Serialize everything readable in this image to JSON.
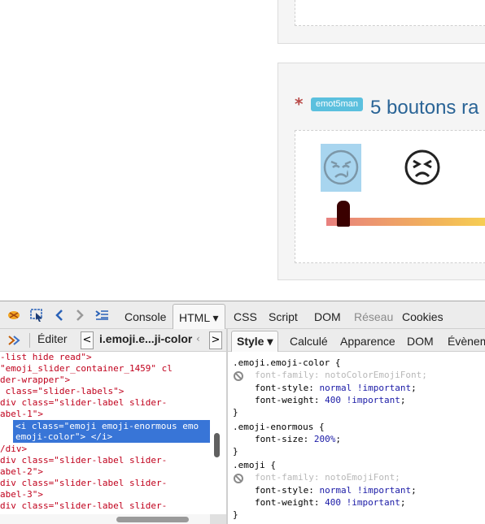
{
  "page": {
    "question": {
      "asterisk": "*",
      "badge": "emot5man",
      "title": "5 boutons ra"
    }
  },
  "devtools": {
    "main_tabs": [
      {
        "label": "Console"
      },
      {
        "label": "HTML",
        "arrow": "▾"
      },
      {
        "label": "CSS"
      },
      {
        "label": "Script"
      },
      {
        "label": "DOM"
      },
      {
        "label": "Réseau"
      },
      {
        "label": "Cookies"
      }
    ],
    "html_toolbar": {
      "edit_label": "Éditer",
      "breadcrumb": "i.emoji.e...ji-color",
      "prev": "<",
      "next": ">",
      "scroll_arrow": "‹"
    },
    "side_tabs": [
      {
        "label": "Style",
        "arrow": "▾"
      },
      {
        "label": "Calculé"
      },
      {
        "label": "Apparence"
      },
      {
        "label": "DOM"
      },
      {
        "label": "Évènem"
      }
    ],
    "html_lines": [
      {
        "text": "-list hide read\">"
      },
      {
        "text": "\"emoji_slider_container_1459\" cl"
      },
      {
        "text": "der-wrapper\">"
      },
      {
        "text": " class=\"slider-labels\">"
      },
      {
        "text": "div class=\"slider-label slider-"
      },
      {
        "text": "abel-1\">"
      },
      {
        "text": "<i class=\"emoji emoji-enormous emo"
      },
      {
        "text": "emoji-color\"> </i>"
      },
      {
        "text": "/div>"
      },
      {
        "text": "div class=\"slider-label slider-"
      },
      {
        "text": "abel-2\">"
      },
      {
        "text": "div class=\"slider-label slider-"
      },
      {
        "text": "abel-3\">"
      },
      {
        "text": "div class=\"slider-label slider-"
      }
    ],
    "css_lines": {
      "r1_selector": ".emoji.emoji-color {",
      "r1_p1": "font-family: notoColorEmojiFont;",
      "r1_p2_name": "font-style",
      "r1_p2_val": "normal !important",
      "r1_p3_name": "font-weight",
      "r1_p3_val": "400 !important",
      "r1_close": "}",
      "r2_selector": ".emoji-enormous {",
      "r2_p1_name": "font-size",
      "r2_p1_val": "200%",
      "r2_close": "}",
      "r3_selector": ".emoji {",
      "r3_p1": "font-family: notoEmojiFont;",
      "r3_p2_name": "font-style",
      "r3_p2_val": "normal !important",
      "r3_p3_name": "font-weight",
      "r3_p3_val": "400 !important",
      "r3_close": "}"
    }
  }
}
